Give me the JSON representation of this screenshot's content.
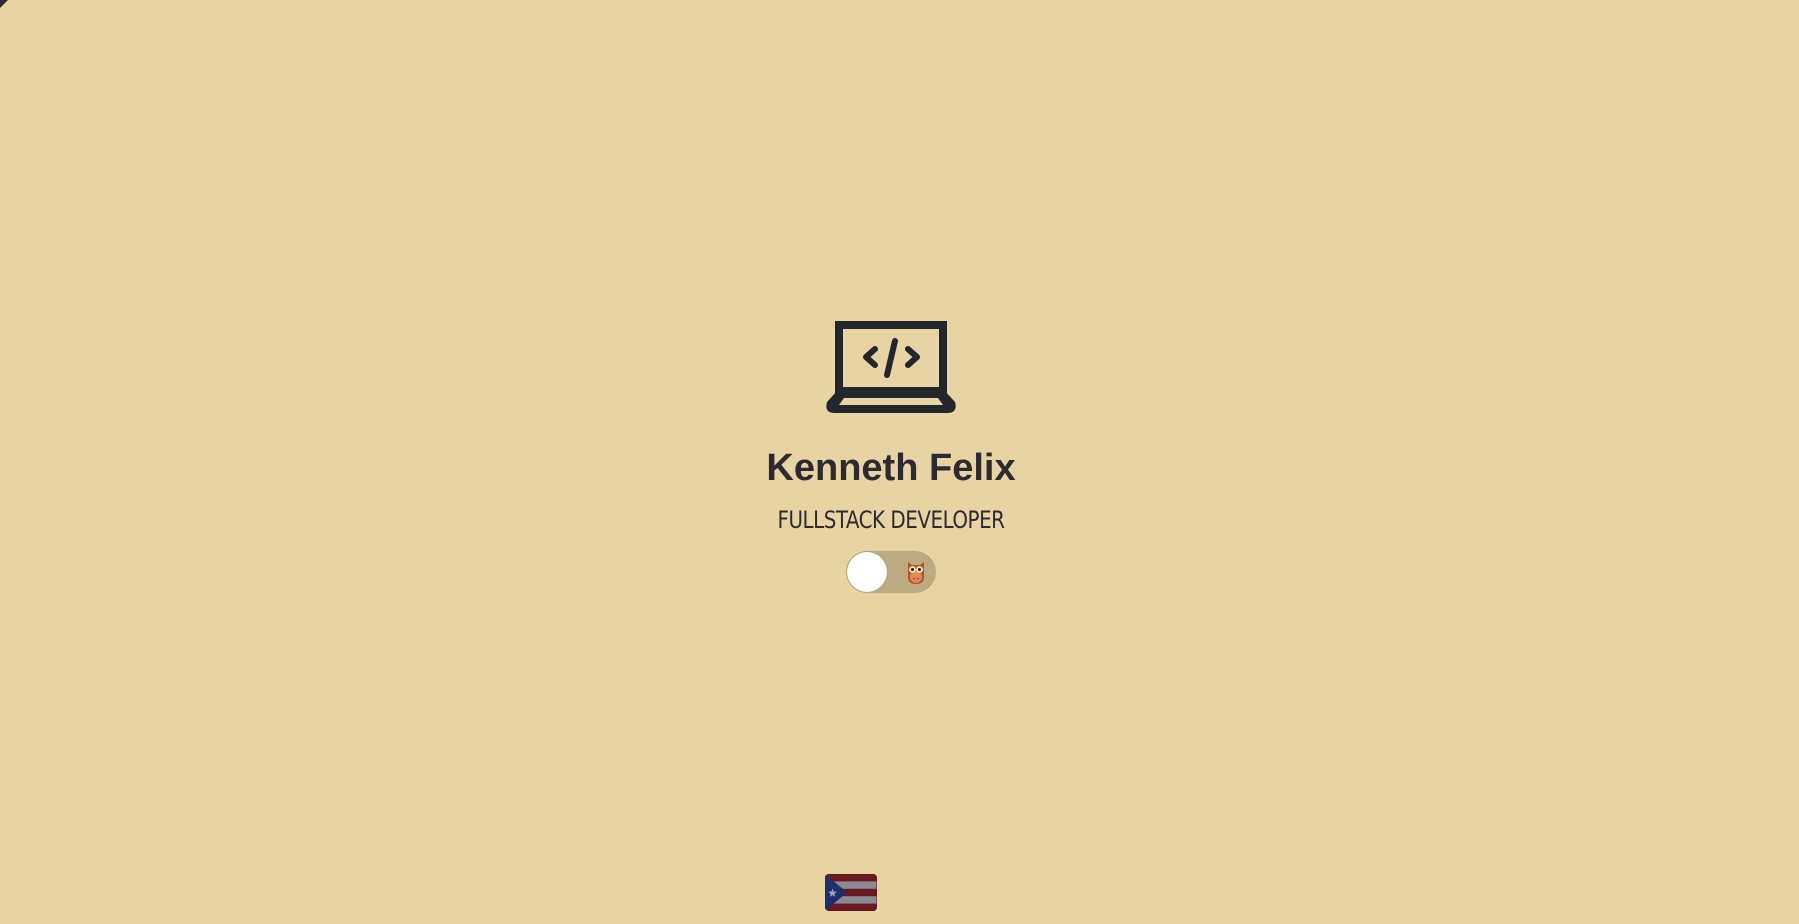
{
  "profile": {
    "name": "Kenneth Felix",
    "title": "FULLSTACK DEVELOPER"
  },
  "theme_toggle": {
    "state": "off",
    "icon": "owl-icon"
  },
  "language": {
    "flag_icon": "puerto-rico-flag-icon"
  },
  "icons": {
    "hero": "laptop-code-icon"
  },
  "colors": {
    "background": "#e8d4a2",
    "text": "#2d2a34",
    "icon": "#23262c",
    "toggle_track": "#bcaa80",
    "toggle_knob": "#ffffff"
  }
}
